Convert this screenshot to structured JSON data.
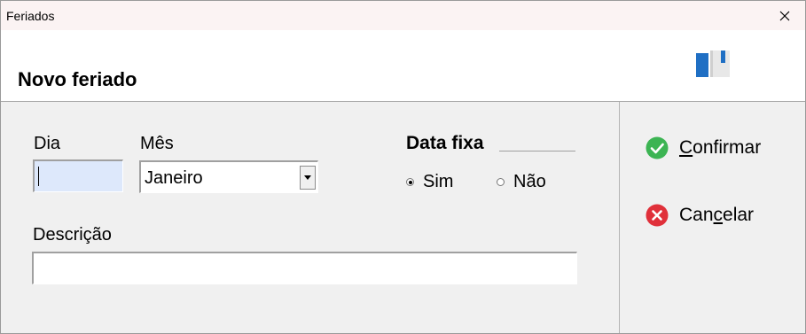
{
  "window": {
    "title": "Feriados"
  },
  "header": {
    "title": "Novo feriado",
    "icon": "book-icon"
  },
  "form": {
    "dia": {
      "label": "Dia",
      "value": ""
    },
    "mes": {
      "label": "Mês",
      "selected": "Janeiro"
    },
    "data_fixa": {
      "label": "Data fixa",
      "options": [
        {
          "label": "Sim",
          "checked": true
        },
        {
          "label": "Não",
          "checked": false
        }
      ]
    },
    "descricao": {
      "label": "Descrição",
      "value": ""
    }
  },
  "actions": {
    "confirm": {
      "prefix": "",
      "accel": "C",
      "rest": "onfirmar",
      "icon": "check-circle-icon",
      "color": "#3cb453"
    },
    "cancel": {
      "prefix": "Can",
      "accel": "c",
      "rest": "elar",
      "icon": "x-circle-icon",
      "color": "#e0303a"
    }
  }
}
